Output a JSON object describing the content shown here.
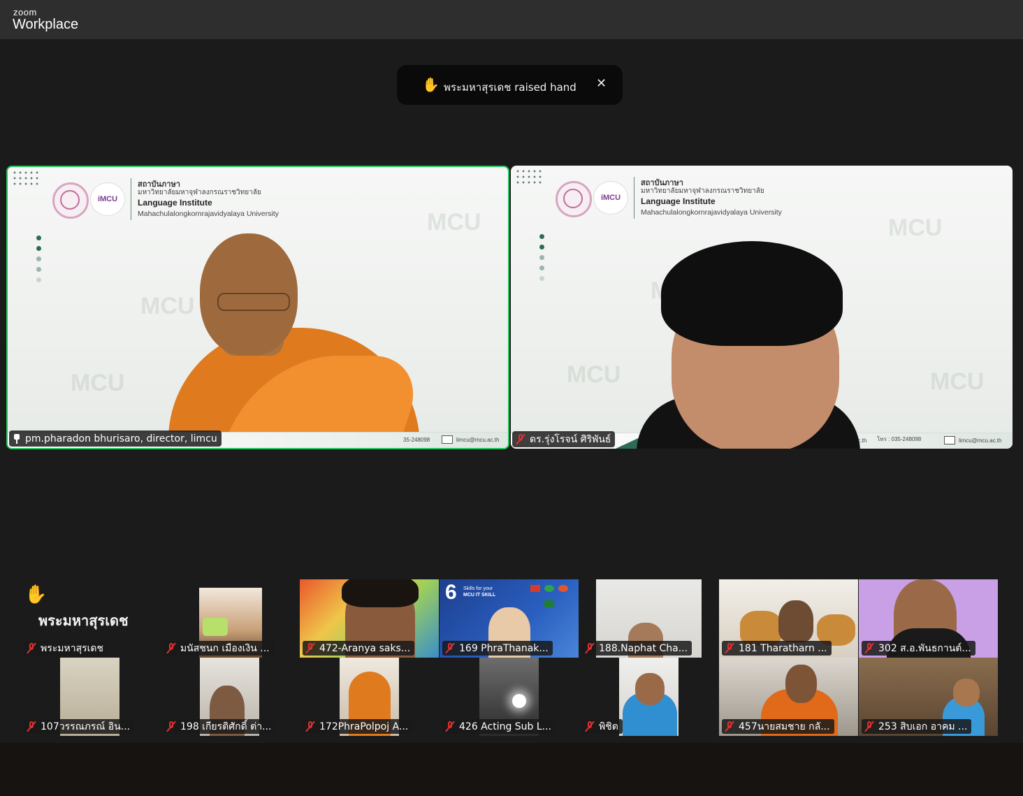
{
  "app": {
    "brand_small": "zoom",
    "brand_big": "Workplace"
  },
  "notification": {
    "hand": "✋",
    "message": "พระมหาสุรเดช raised hand",
    "close": "✕"
  },
  "slide": {
    "thai_title": "สถาบันภาษา",
    "thai_subtitle": "มหาวิทยาลัยมหาจุฬาลงกรณราชวิทยาลัย",
    "en_title": "Language Institute",
    "en_subtitle": "Mahachulalongkornrajavidyalaya University",
    "logo_text": "iMCU",
    "phone_1": "35-248098",
    "phone_2": "โทร : 035-248098",
    "email": "limcu@mcu.ac.th",
    "ac_th": "ac.th"
  },
  "main_videos": [
    {
      "name": "pm.pharadon bhurisaro, director, limcu",
      "pinned": true,
      "active": true
    },
    {
      "name": "ดร.รุ่งโรจน์  ศิริพันธ์",
      "muted": true
    }
  ],
  "raised_hand": {
    "icon": "✋",
    "big_name": "พระมหาสุรเดช"
  },
  "gallery": [
    {
      "name": "พระมหาสุรเดช",
      "muted": true
    },
    {
      "name": "มนัสชนก เมืองเงิน ...",
      "muted": true
    },
    {
      "name": "472-Aranya saks...",
      "muted": true
    },
    {
      "name": "169 PhraThanak...",
      "muted": true
    },
    {
      "name": "188.Naphat Cha...",
      "muted": true
    },
    {
      "name": "181 Tharatharn ...",
      "muted": true
    },
    {
      "name": "302 ส.อ.พันธกานต์...",
      "muted": true
    },
    {
      "name": "107วรรณภรณ์ อิน...",
      "muted": true
    },
    {
      "name": "198 เกียรติศักดิ์ ต่า...",
      "muted": true
    },
    {
      "name": "172PhraPolpoj A...",
      "muted": true
    },
    {
      "name": "426 Acting Sub L...",
      "muted": true
    },
    {
      "name": "พิชิต",
      "muted": true
    },
    {
      "name": "457นายสมชาย กลั...",
      "muted": true
    },
    {
      "name": "253 สิบเอก อาคม ...",
      "muted": true
    }
  ],
  "tile_texts": {
    "mcu_skill_num": "6",
    "mcu_skill": "MCU IT SKILL",
    "skills_for": "Skills for your"
  },
  "colors": {
    "active_speaker": "#21c35a",
    "muted_icon": "#e03030",
    "background": "#1b1b1b",
    "titlebar": "#2e2e2e"
  }
}
